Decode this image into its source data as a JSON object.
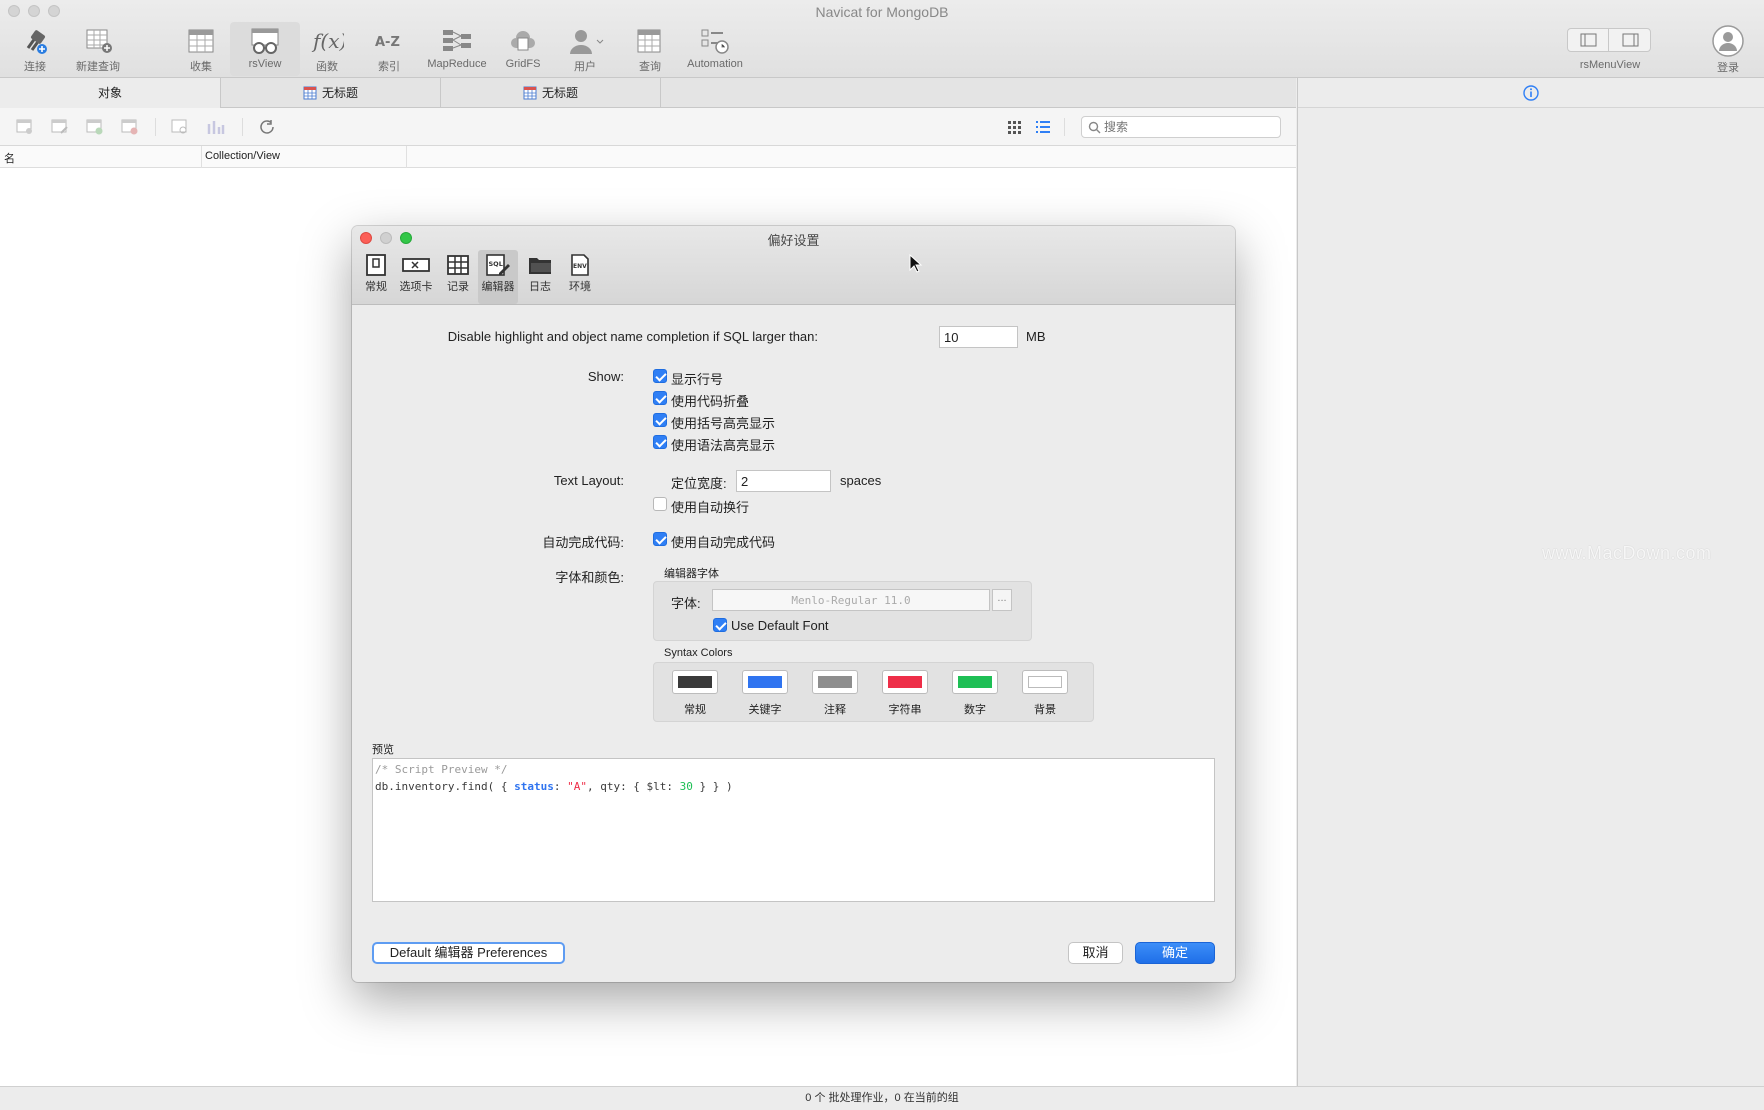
{
  "app": {
    "title": "Navicat for MongoDB"
  },
  "toolbar": {
    "items": [
      {
        "label": "连接",
        "icon": "connect-icon"
      },
      {
        "label": "新建查询",
        "icon": "new-query-icon"
      },
      {
        "label": "收集",
        "icon": "collection-icon"
      },
      {
        "label": "rsView",
        "icon": "view-icon"
      },
      {
        "label": "函数",
        "icon": "function-icon"
      },
      {
        "label": "索引",
        "icon": "index-icon"
      },
      {
        "label": "MapReduce",
        "icon": "mapreduce-icon"
      },
      {
        "label": "GridFS",
        "icon": "gridfs-icon"
      },
      {
        "label": "用户",
        "icon": "user-icon"
      },
      {
        "label": "查询",
        "icon": "query-icon"
      },
      {
        "label": "Automation",
        "icon": "automation-icon"
      }
    ],
    "right_label": "rsMenuView",
    "login_label": "登录"
  },
  "tabs": [
    {
      "label": "对象"
    },
    {
      "label": "无标题"
    },
    {
      "label": "无标题"
    }
  ],
  "search": {
    "placeholder": "搜索",
    "value": ""
  },
  "columns": [
    {
      "label": "名"
    },
    {
      "label": "Collection/View"
    }
  ],
  "status": {
    "text": "0 个 批处理作业，0 在当前的组"
  },
  "watermark": "www.MacDown.com",
  "dialog": {
    "title": "偏好设置",
    "pref_tabs": [
      {
        "label": "常规",
        "icon": "general-icon"
      },
      {
        "label": "选项卡",
        "icon": "tabs-icon"
      },
      {
        "label": "记录",
        "icon": "records-icon"
      },
      {
        "label": "编辑器",
        "icon": "editor-icon",
        "active": true
      },
      {
        "label": "日志",
        "icon": "log-icon"
      },
      {
        "label": "环境",
        "icon": "environment-icon"
      }
    ],
    "disable_highlight": {
      "label": "Disable highlight and object name completion if SQL larger than:",
      "value": "10",
      "unit": "MB"
    },
    "show": {
      "label": "Show:",
      "options": [
        {
          "label": "显示行号",
          "checked": true
        },
        {
          "label": "使用代码折叠",
          "checked": true
        },
        {
          "label": "使用括号高亮显示",
          "checked": true
        },
        {
          "label": "使用语法高亮显示",
          "checked": true
        }
      ]
    },
    "text_layout": {
      "label": "Text Layout:",
      "tab_width_label": "定位宽度:",
      "tab_width_value": "2",
      "tab_width_unit": "spaces",
      "word_wrap": {
        "label": "使用自动换行",
        "checked": false
      }
    },
    "autocomplete": {
      "label": "自动完成代码:",
      "option": {
        "label": "使用自动完成代码",
        "checked": true
      }
    },
    "font_color": {
      "label": "字体和颜色:",
      "editor_font_title": "编辑器字体",
      "font_label": "字体:",
      "font_value": "Menlo-Regular 11.0",
      "browse_label": "...",
      "use_default_font": {
        "label": "Use Default Font",
        "checked": true
      },
      "syntax_title": "Syntax Colors",
      "swatches": [
        {
          "label": "常规",
          "color": "#3a3a3a"
        },
        {
          "label": "关键字",
          "color": "#2f74f0"
        },
        {
          "label": "注释",
          "color": "#8e8e8e"
        },
        {
          "label": "字符串",
          "color": "#ee2e48"
        },
        {
          "label": "数字",
          "color": "#1ebf55"
        },
        {
          "label": "背景",
          "color": "#ffffff"
        }
      ]
    },
    "preview": {
      "label": "预览",
      "line1": "/* Script Preview */",
      "line2": {
        "p1": "db.inventory.find( { ",
        "keyword": "status",
        "p2": ": ",
        "string": "\"A\"",
        "p3": ", qty: { $lt: ",
        "number": "30",
        "p4": " } } )"
      }
    },
    "buttons": {
      "defaults": "Default 编辑器 Preferences",
      "cancel": "取消",
      "ok": "确定"
    }
  }
}
